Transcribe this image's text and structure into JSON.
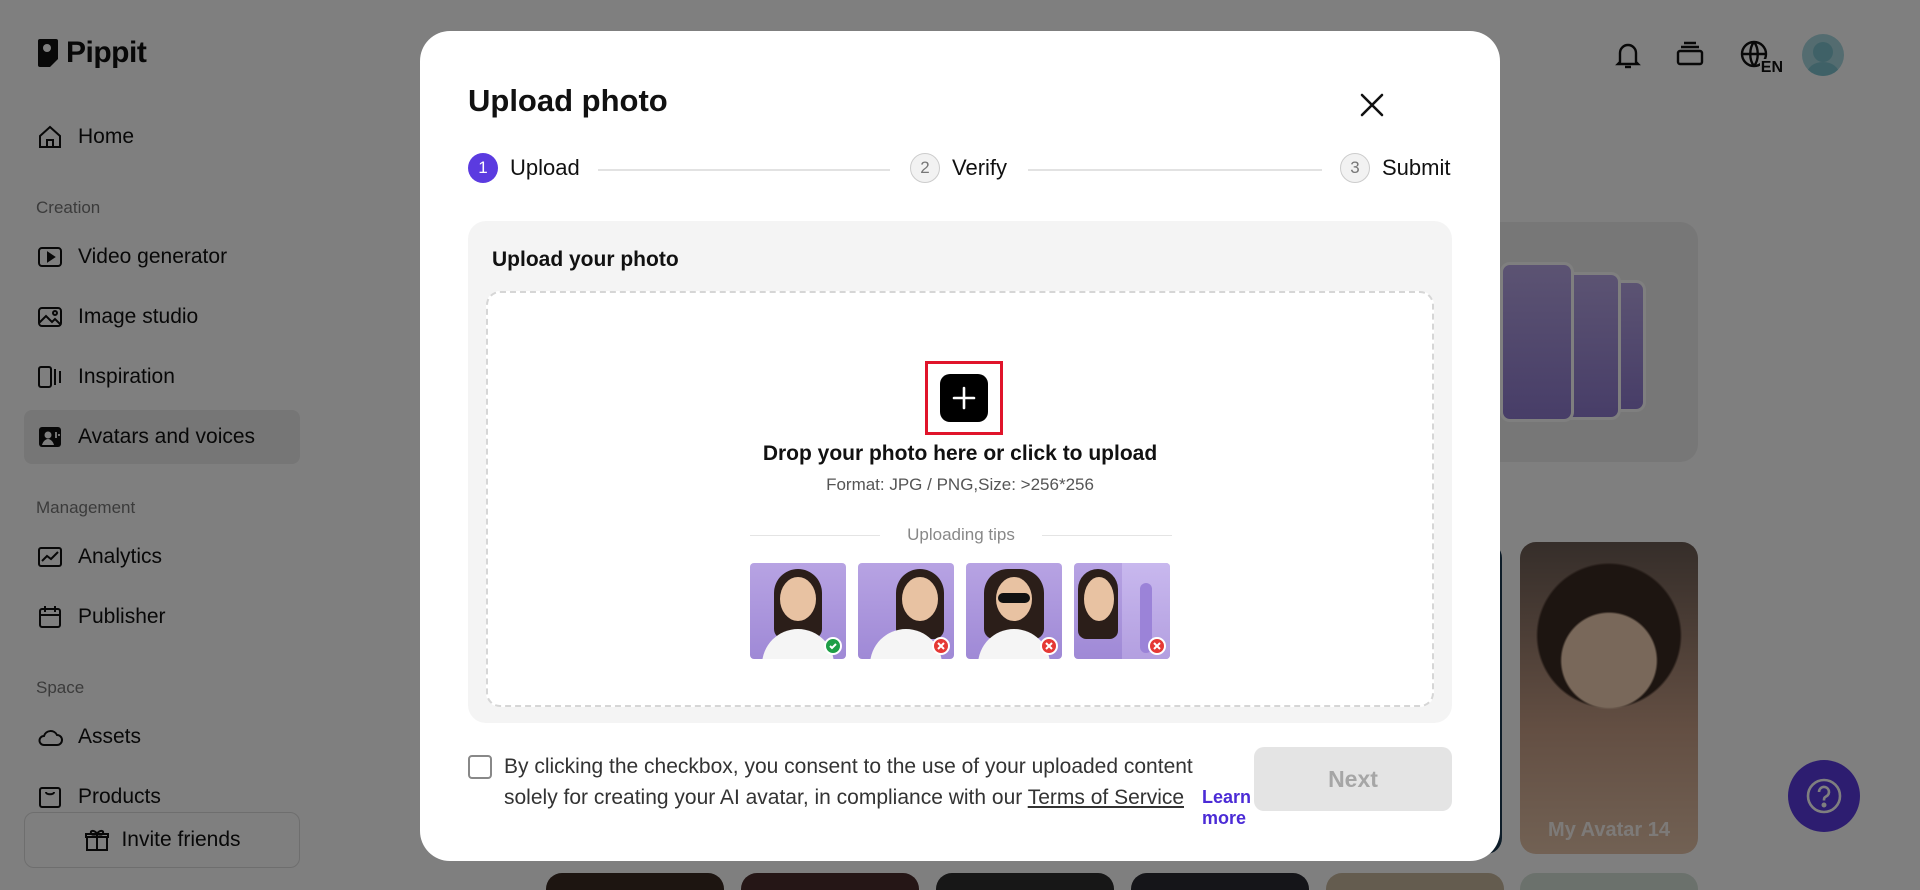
{
  "app": {
    "logo_text": "Pippit"
  },
  "sidebar": {
    "home": "Home",
    "section_creation": "Creation",
    "video_generator": "Video generator",
    "image_studio": "Image studio",
    "inspiration": "Inspiration",
    "avatars_and_voices": "Avatars and voices",
    "section_management": "Management",
    "analytics": "Analytics",
    "publisher": "Publisher",
    "section_space": "Space",
    "assets": "Assets",
    "products": "Products",
    "invite_friends": "Invite friends"
  },
  "topbar": {
    "language_badge": "EN"
  },
  "background": {
    "avatar_card_label": "My Avatar 14"
  },
  "modal": {
    "title": "Upload photo",
    "steps": [
      {
        "number": "1",
        "label": "Upload",
        "state": "active"
      },
      {
        "number": "2",
        "label": "Verify",
        "state": "idle"
      },
      {
        "number": "3",
        "label": "Submit",
        "state": "idle"
      }
    ],
    "panel_title": "Upload your photo",
    "drop_text": "Drop your photo here or click to upload",
    "format_text": "Format: JPG / PNG,Size: >256*256",
    "tips_label": "Uploading tips",
    "tip_images": [
      {
        "kind": "front-face",
        "status": "ok"
      },
      {
        "kind": "side-profile",
        "status": "rejected"
      },
      {
        "kind": "sunglasses",
        "status": "rejected"
      },
      {
        "kind": "multiple-shots",
        "status": "rejected"
      }
    ],
    "consent_text_prefix": "By clicking the checkbox, you consent to the use of your uploaded content solely for creating your AI avatar, in compliance with our ",
    "consent_terms_link": "Terms of Service",
    "learn_more": "Learn more",
    "next_button": "Next"
  },
  "colors": {
    "accent": "#5b3be0",
    "highlight_frame": "#e0142a",
    "ok_badge": "#1e9e46",
    "reject_badge": "#e53935"
  }
}
